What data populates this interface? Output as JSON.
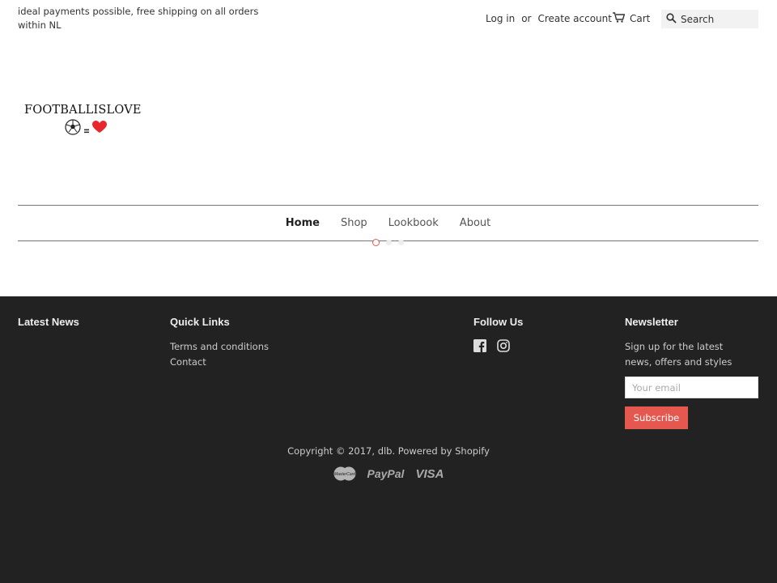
{
  "header": {
    "announcement": "ideal payments possible, free shipping on all orders within NL",
    "login_label": "Log in",
    "or_label": "or",
    "create_account_label": "Create account",
    "cart_label": "Cart",
    "search_placeholder": "Search"
  },
  "logo": {
    "text": "FOOTBALLISLOVE"
  },
  "nav": {
    "items": [
      {
        "label": "Home",
        "active": true
      },
      {
        "label": "Shop"
      },
      {
        "label": "Lookbook"
      },
      {
        "label": "About"
      }
    ]
  },
  "footer": {
    "latest_news_title": "Latest News",
    "quick_links_title": "Quick Links",
    "quick_links": [
      "Terms and conditions",
      "Contact"
    ],
    "follow_us_title": "Follow Us",
    "social_icons": [
      "facebook-icon",
      "instagram-icon"
    ],
    "newsletter_title": "Newsletter",
    "newsletter_text": "Sign up for the latest news, offers and styles",
    "email_placeholder": "Your email",
    "subscribe_label": "Subscribe",
    "copyright": "Copyright © 2017, dlb. Powered by Shopify",
    "payments": [
      "MasterCard",
      "PayPal",
      "VISA"
    ]
  },
  "colors": {
    "accent": "#e5584f",
    "footer_bg": "#222222",
    "heart": "#e8262e"
  }
}
